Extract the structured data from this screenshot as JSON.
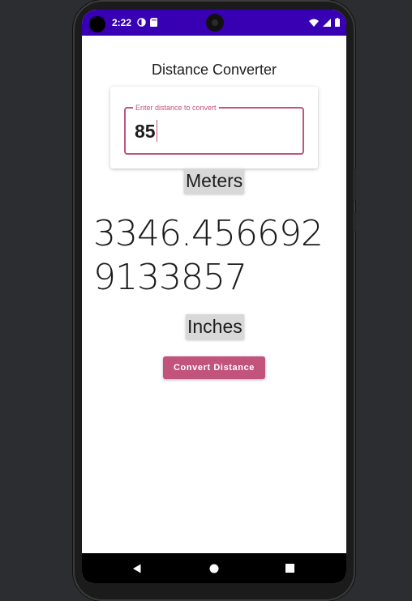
{
  "status_bar": {
    "time": "2:22",
    "background_color": "#3700b3"
  },
  "app": {
    "title": "Distance Converter",
    "accent_color": "#c2537a"
  },
  "input": {
    "label": "Enter distance to convert",
    "value": "85"
  },
  "from_unit": {
    "label": "Meters"
  },
  "result": {
    "value": "3346.4566929133857"
  },
  "to_unit": {
    "label": "Inches"
  },
  "convert_button": {
    "label": "Convert Distance"
  },
  "nav_bar": {
    "icons": [
      "back-icon",
      "home-icon",
      "recents-icon"
    ]
  }
}
